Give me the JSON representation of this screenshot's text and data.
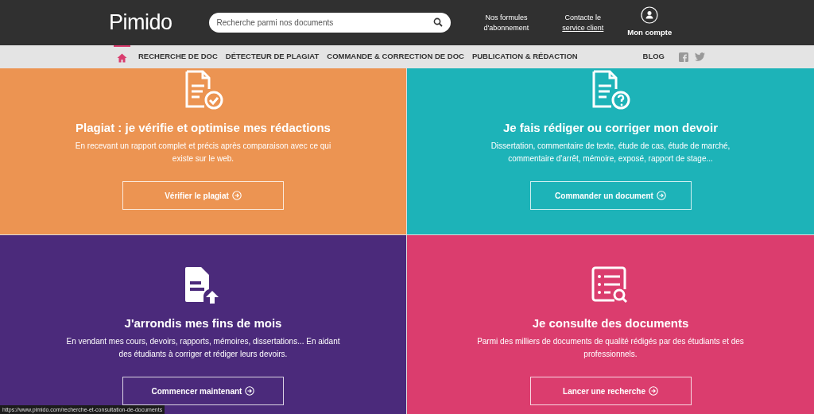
{
  "header": {
    "logo": "Pimido",
    "search": {
      "placeholder": "Recherche parmi nos documents"
    },
    "links": [
      {
        "kind": "plain",
        "lines": [
          "Nos formules",
          "d'abonnement"
        ]
      },
      {
        "kind": "underlined",
        "lines": [
          "Contacte le",
          "service client"
        ]
      }
    ],
    "account": {
      "label": "Mon compte"
    }
  },
  "nav": {
    "items": [
      {
        "kind": "home",
        "selected": true
      },
      {
        "kind": "text",
        "label": "RECHERCHE DE DOC",
        "selected": false
      },
      {
        "kind": "text",
        "label": "DÉTECTEUR DE PLAGIAT",
        "selected": false
      },
      {
        "kind": "text",
        "label": "COMMANDE & CORRECTION DE DOC",
        "selected": false
      },
      {
        "kind": "text",
        "label": "PUBLICATION & RÉDACTION",
        "selected": false
      }
    ],
    "blog": "BLOG"
  },
  "panels": [
    {
      "kind": "doc-check",
      "color": "#ec9452",
      "title": "Plagiat : je vérifie et optimise mes rédactions",
      "text": "En recevant un rapport complet et précis après comparaison avec ce qui existe sur le web.",
      "button": "Vérifier le plagiat"
    },
    {
      "kind": "doc-question",
      "color": "#1db3b8",
      "title": "Je fais rédiger ou corriger mon devoir",
      "text": "Dissertation, commentaire de texte, étude de cas, étude de marché, commentaire d'arrêt, mémoire, exposé, rapport de stage...",
      "button": "Commander un document"
    },
    {
      "kind": "doc-upload",
      "color": "#4b2a7b",
      "title": "J'arrondis mes fins de mois",
      "text": "En vendant mes cours, devoirs, rapports, mémoires, dissertations... En aidant des étudiants à corriger et rédiger leurs devoirs.",
      "button": "Commencer maintenant"
    },
    {
      "kind": "list-search",
      "color": "#db3d6e",
      "title": "Je consulte des documents",
      "text": "Parmi des milliers de documents de qualité rédigés par des étudiants et des professionnels.",
      "button": "Lancer une recherche"
    }
  ],
  "status_bar": "https://www.pimido.com/recherche-et-consultation-de-documents"
}
